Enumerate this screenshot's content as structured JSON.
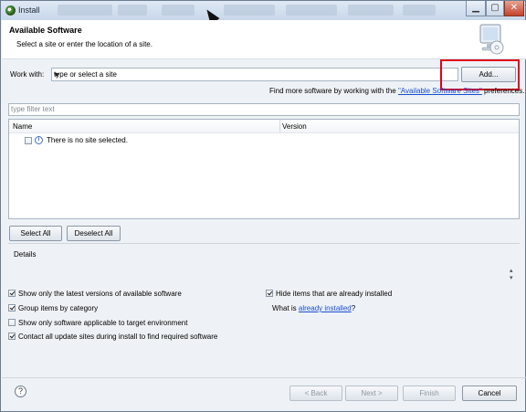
{
  "window": {
    "title": "Install"
  },
  "header": {
    "title": "Available Software",
    "subtitle": "Select a site or enter the location of a site."
  },
  "work_with": {
    "label": "Work with:",
    "value": "type or select a site",
    "add_button": "Add..."
  },
  "find_more": {
    "prefix": "Find more software by working with the ",
    "link": "\"Available Software Sites\"",
    "suffix": " preferences."
  },
  "filter": {
    "placeholder": "type filter text"
  },
  "table": {
    "columns": [
      "Name",
      "Version"
    ],
    "rows": [
      {
        "name": "There is no site selected.",
        "version": ""
      }
    ]
  },
  "selection_buttons": {
    "select_all": "Select All",
    "deselect_all": "Deselect All"
  },
  "details": {
    "label": "Details"
  },
  "options": {
    "latest_versions": {
      "label": "Show only the latest versions of available software",
      "checked": true
    },
    "hide_installed": {
      "label": "Hide items that are already installed",
      "checked": true
    },
    "group_by_category": {
      "label": "Group items by category",
      "checked": true
    },
    "applicable_only": {
      "label": "Show only software applicable to target environment",
      "checked": false
    },
    "contact_update_sites": {
      "label": "Contact all update sites during install to find required software",
      "checked": true
    }
  },
  "what_is": {
    "prefix": "What is ",
    "link": "already installed",
    "suffix": "?"
  },
  "footer": {
    "back": "< Back",
    "next": "Next >",
    "finish": "Finish",
    "cancel": "Cancel"
  },
  "icons": {
    "app": "eclipse-icon",
    "header": "monitor-cd-icon",
    "info": "info-icon",
    "help": "help-icon"
  }
}
